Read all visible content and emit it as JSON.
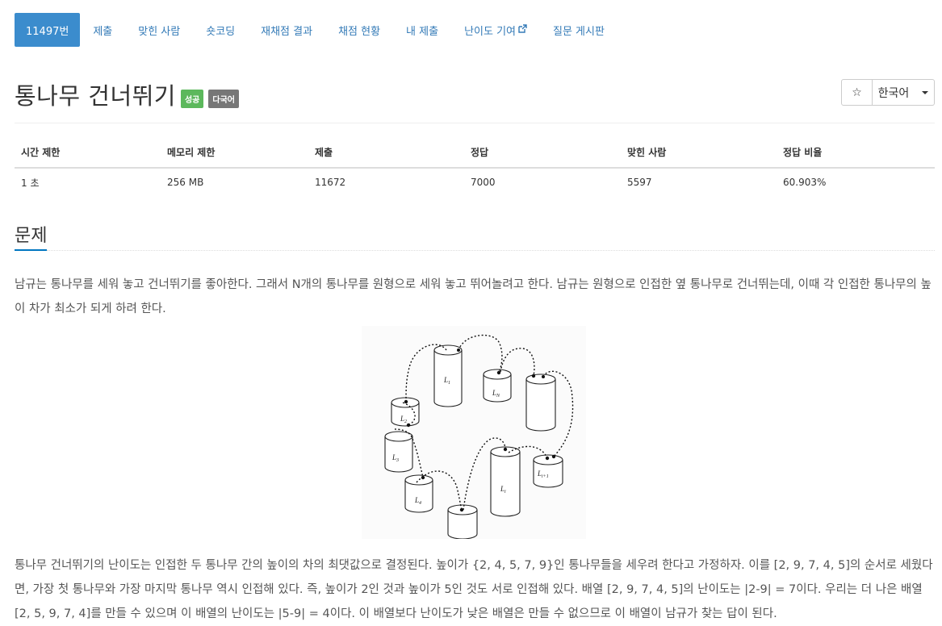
{
  "tabs": [
    {
      "label": "11497번",
      "active": true
    },
    {
      "label": "제출"
    },
    {
      "label": "맞힌 사람"
    },
    {
      "label": "숏코딩"
    },
    {
      "label": "재채점 결과"
    },
    {
      "label": "채점 현황"
    },
    {
      "label": "내 제출"
    },
    {
      "label": "난이도 기여"
    },
    {
      "label": "질문 게시판"
    }
  ],
  "problem": {
    "title": "통나무 건너뛰기",
    "badges": [
      "성공",
      "다국어"
    ],
    "star_icon": "☆",
    "language": "한국어"
  },
  "info_table": {
    "headers": [
      "시간 제한",
      "메모리 제한",
      "제출",
      "정답",
      "맞힌 사람",
      "정답 비율"
    ],
    "values": [
      "1 초",
      "256 MB",
      "11672",
      "7000",
      "5597",
      "60.903%"
    ]
  },
  "section": {
    "title": "문제",
    "para1": "남규는 통나무를 세워 놓고 건너뛰기를 좋아한다. 그래서 N개의 통나무를 원형으로 세워 놓고 뛰어놀려고 한다. 남규는 원형으로 인접한 옆 통나무로 건너뛰는데, 이때 각 인접한 통나무의 높이 차가 최소가 되게 하려 한다.",
    "para2": "통나무 건너뛰기의 난이도는 인접한 두 통나무 간의 높이의 차의 최댓값으로 결정된다. 높이가 {2, 4, 5, 7, 9}인 통나무들을 세우려 한다고 가정하자. 이를 [2, 9, 7, 4, 5]의 순서로 세웠다면, 가장 첫 통나무와 가장 마지막 통나무 역시 인접해 있다. 즉, 높이가 2인 것과 높이가 5인 것도 서로 인접해 있다. 배열 [2, 9, 7, 4, 5]의 난이도는 |2-9| = 7이다. 우리는 더 나은 배열 [2, 5, 9, 7, 4]를 만들 수 있으며 이 배열의 난이도는 |5-9| = 4이다. 이 배열보다 난이도가 낮은 배열은 만들 수 없으므로 이 배열이 남규가 찾는 답이 된다."
  },
  "figure_labels": {
    "l1": "L",
    "l1_sub": "1",
    "ln": "L",
    "ln_sub": "N",
    "l2": "L",
    "l2_sub": "2",
    "l3": "L",
    "l3_sub": "3",
    "l4": "L",
    "l4_sub": "4",
    "li": "L",
    "li_sub": "i",
    "li1": "L",
    "li1_sub": "i+1"
  }
}
